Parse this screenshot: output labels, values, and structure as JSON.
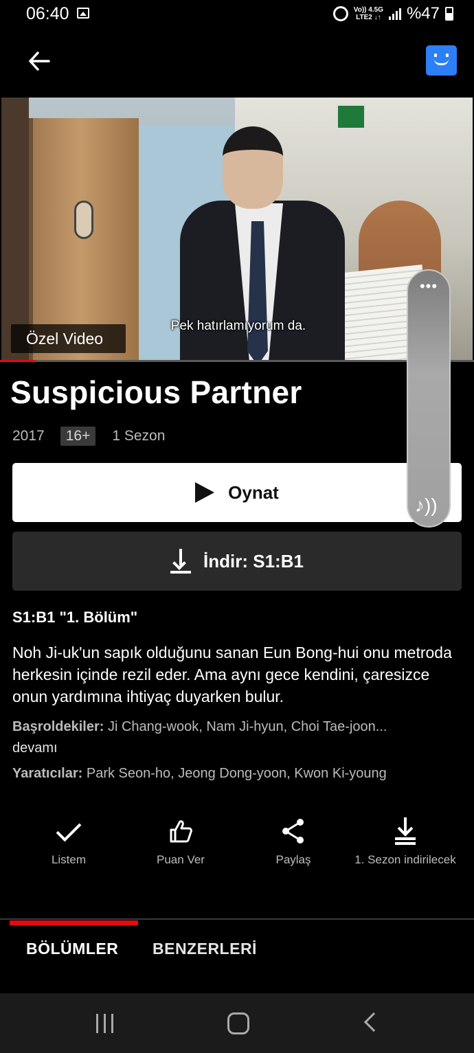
{
  "status_bar": {
    "time": "06:40",
    "net_top": "Vo)) 4.5G",
    "net_bottom": "LTE2 ↓↑",
    "battery": "%47"
  },
  "header": {
    "back_icon": "arrow-left-icon",
    "profile_color": "#2d7ff5"
  },
  "video": {
    "badge": "Özel Video",
    "subtitle": "Pek hatırlamıyorum da.",
    "progress_fraction": 0.075
  },
  "title": "Suspicious Partner",
  "meta": {
    "year": "2017",
    "rating": "16+",
    "seasons": "1 Sezon"
  },
  "buttons": {
    "play": "Oynat",
    "download": "İndir: S1:B1"
  },
  "side_panel": {
    "dots": "•••",
    "sound_icon": "♪))"
  },
  "episode": {
    "title": "S1:B1 \"1. Bölüm\"",
    "description": "Noh Ji-uk'un sapık olduğunu sanan Eun Bong-hui onu metroda herkesin içinde rezil eder. Ama aynı gece kendini, çaresizce onun yardımına ihtiyaç duyarken bulur.",
    "cast_label": "Başroldekiler:",
    "cast": " Ji Chang-wook, Nam Ji-hyun, Choi Tae-joon...",
    "more": "devamı",
    "creators_label": "Yaratıcılar:",
    "creators": " Park Seon-ho, Jeong Dong-yoon, Kwon Ki-young"
  },
  "actions": [
    {
      "label": "Listem",
      "icon": "check-icon"
    },
    {
      "label": "Puan Ver",
      "icon": "thumbs-up-icon"
    },
    {
      "label": "Paylaş",
      "icon": "share-icon"
    },
    {
      "label": "1. Sezon indirilecek",
      "icon": "download-icon"
    }
  ],
  "tabs": [
    "BÖLÜMLER",
    "BENZERLERİ"
  ],
  "colors": {
    "accent": "#e50914",
    "background": "#000000"
  }
}
